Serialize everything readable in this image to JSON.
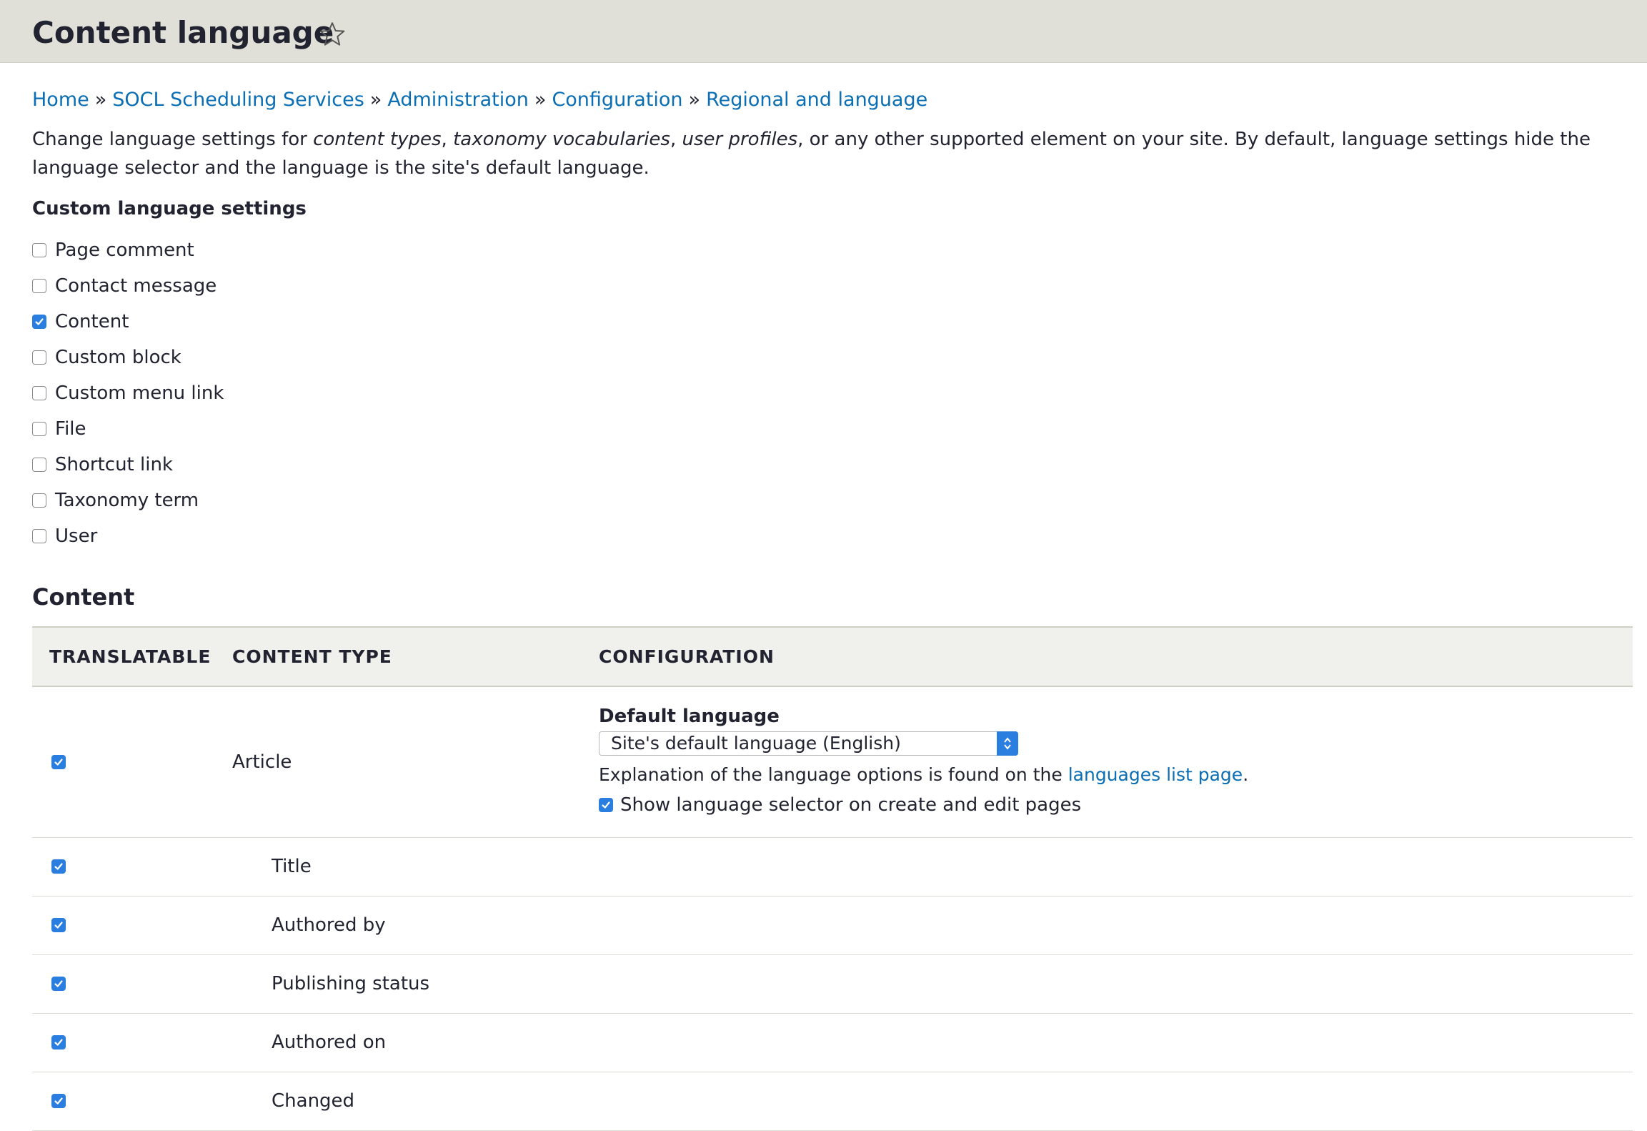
{
  "page": {
    "title": "Content language"
  },
  "breadcrumb": [
    {
      "label": "Home"
    },
    {
      "label": "SOCL Scheduling Services"
    },
    {
      "label": "Administration"
    },
    {
      "label": "Configuration"
    },
    {
      "label": "Regional and language"
    }
  ],
  "breadcrumb_separator": "»",
  "description": {
    "part1": "Change language settings for ",
    "em1": "content types",
    "part2": ", ",
    "em2": "taxonomy vocabularies",
    "part3": ", ",
    "em3": "user profiles",
    "part4": ", or any other supported element on your site. By default, language settings hide the language selector and the language is the site's default language."
  },
  "custom_settings": {
    "label": "Custom language settings",
    "items": [
      {
        "label": "Page comment",
        "checked": false
      },
      {
        "label": "Contact message",
        "checked": false
      },
      {
        "label": "Content",
        "checked": true
      },
      {
        "label": "Custom block",
        "checked": false
      },
      {
        "label": "Custom menu link",
        "checked": false
      },
      {
        "label": "File",
        "checked": false
      },
      {
        "label": "Shortcut link",
        "checked": false
      },
      {
        "label": "Taxonomy term",
        "checked": false
      },
      {
        "label": "User",
        "checked": false
      }
    ]
  },
  "content_section": {
    "heading": "Content",
    "columns": {
      "translatable": "TRANSLATABLE",
      "content_type": "CONTENT TYPE",
      "configuration": "CONFIGURATION"
    },
    "article": {
      "name": "Article",
      "translatable": true,
      "default_language_label": "Default language",
      "default_language_value": "Site's default language (English)",
      "help_text": "Explanation of the language options is found on the ",
      "help_link": "languages list page",
      "help_suffix": ".",
      "show_selector_label": "Show language selector on create and edit pages",
      "show_selector_checked": true
    },
    "fields": [
      {
        "name": "Title",
        "translatable": true
      },
      {
        "name": "Authored by",
        "translatable": true
      },
      {
        "name": "Publishing status",
        "translatable": true
      },
      {
        "name": "Authored on",
        "translatable": true
      },
      {
        "name": "Changed",
        "translatable": true
      }
    ]
  },
  "colors": {
    "header_bg": "#e0e0d8",
    "link": "#0a6eb4",
    "checkbox_checked": "#2a7ee0"
  }
}
